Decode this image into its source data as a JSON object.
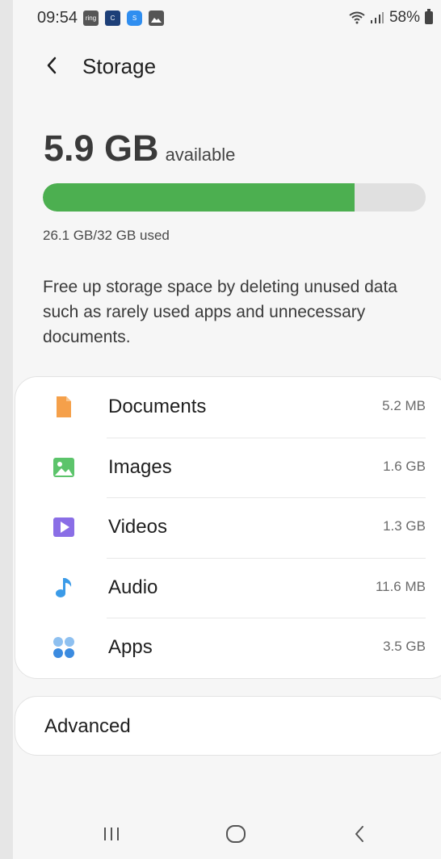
{
  "status_bar": {
    "time": "09:54",
    "battery": "58%",
    "notification_icons": [
      "ring",
      "news",
      "s",
      "gallery"
    ]
  },
  "header": {
    "title": "Storage",
    "back_icon": "back-arrow-icon"
  },
  "summary": {
    "available_value": "5.9 GB",
    "available_label": "available",
    "used_text": "26.1 GB/32 GB used",
    "used_fraction": 0.815,
    "bar_color": "#4caf50",
    "info_text": "Free up storage space by deleting unused data such as rarely used apps and unnecessary documents."
  },
  "categories": [
    {
      "name": "Documents",
      "size": "5.2 MB",
      "icon": "document-icon",
      "color": "#f5a04a"
    },
    {
      "name": "Images",
      "size": "1.6 GB",
      "icon": "image-icon",
      "color": "#5cc46b"
    },
    {
      "name": "Videos",
      "size": "1.3 GB",
      "icon": "video-icon",
      "color": "#8a6ee6"
    },
    {
      "name": "Audio",
      "size": "11.6 MB",
      "icon": "music-note-icon",
      "color": "#3b9be8"
    },
    {
      "name": "Apps",
      "size": "3.5 GB",
      "icon": "apps-icon",
      "color": "#3b8be0"
    }
  ],
  "advanced": {
    "label": "Advanced"
  },
  "nav_bar": {
    "recents_icon": "recents-icon",
    "home_icon": "home-icon",
    "back_icon": "nav-back-icon"
  }
}
